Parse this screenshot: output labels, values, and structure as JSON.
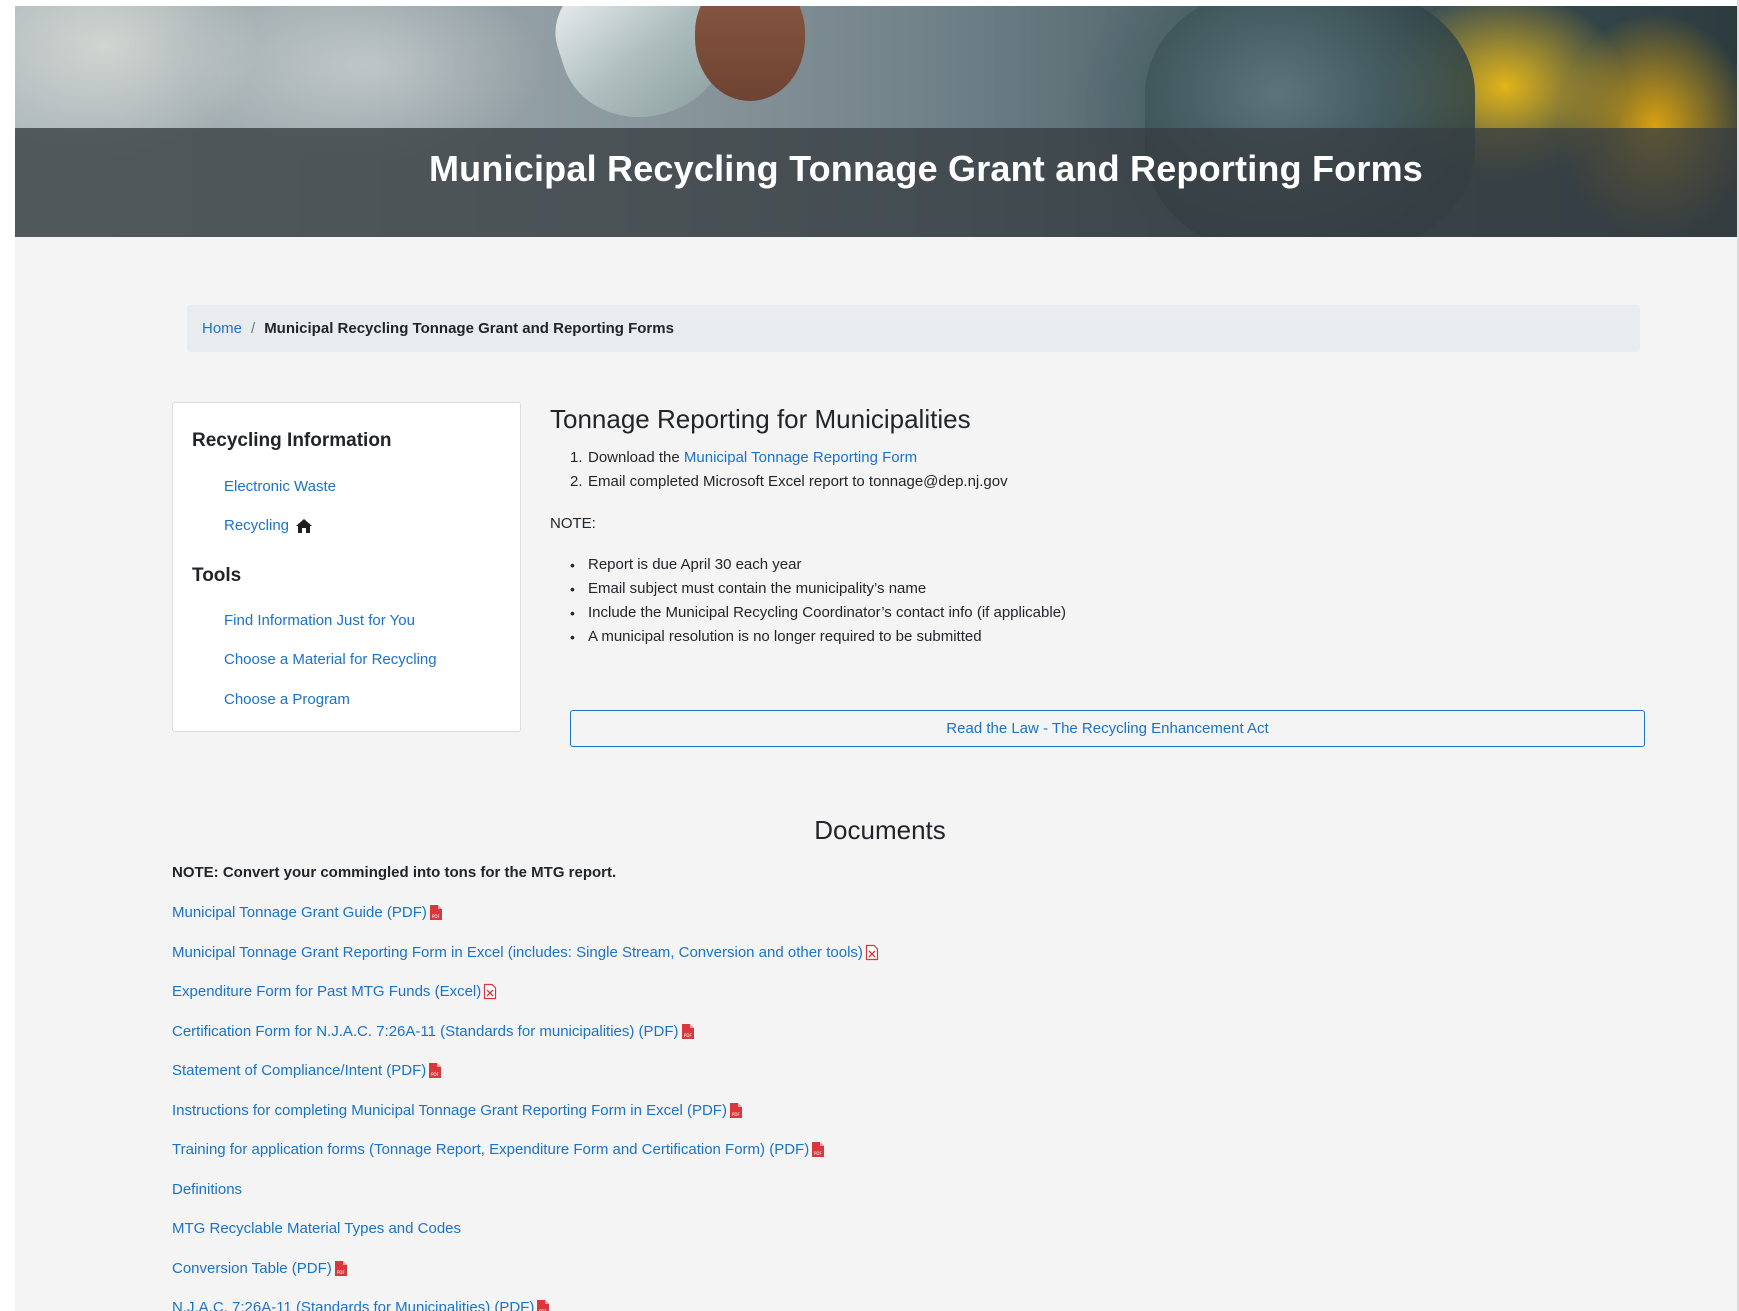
{
  "hero": {
    "title": "Municipal Recycling Tonnage Grant and Reporting Forms"
  },
  "breadcrumb": {
    "home": "Home",
    "separator": "/",
    "current": "Municipal Recycling Tonnage Grant and Reporting Forms"
  },
  "sidebar": {
    "section1_title": "Recycling Information",
    "section1_items": [
      {
        "label": "Electronic Waste"
      },
      {
        "label": "Recycling",
        "icon": "home-icon"
      }
    ],
    "section2_title": "Tools",
    "section2_items": [
      {
        "label": "Find Information Just for You"
      },
      {
        "label": "Choose a Material for Recycling"
      },
      {
        "label": "Choose a Program"
      }
    ]
  },
  "main": {
    "heading": "Tonnage Reporting for Municipalities",
    "steps": [
      {
        "num": "1.",
        "prefix": "Download the ",
        "link": "Municipal Tonnage Reporting Form"
      },
      {
        "num": "2.",
        "text": "Email completed Microsoft Excel report to tonnage@dep.nj.gov"
      }
    ],
    "note_label": "NOTE:",
    "notes": [
      "Report is due April 30 each year",
      "Email subject must contain the municipality’s name",
      "Include the Municipal Recycling Coordinator’s contact info (if applicable)",
      "A municipal resolution is no longer required to be submitted"
    ],
    "law_button": "Read the Law - The Recycling Enhancement Act"
  },
  "documents": {
    "title": "Documents",
    "note": "NOTE: Convert your commingled into tons for the MTG report.",
    "links": [
      {
        "label": "Municipal Tonnage Grant Guide (PDF)",
        "icon": "pdf-icon"
      },
      {
        "label": "Municipal Tonnage Grant Reporting Form in Excel (includes: Single Stream, Conversion and other tools)",
        "icon": "excel-icon"
      },
      {
        "label": "Expenditure Form for Past MTG Funds (Excel)",
        "icon": "excel-icon"
      },
      {
        "label": "Certification Form for N.J.A.C. 7:26A-11 (Standards for municipalities) (PDF)",
        "icon": "pdf-icon"
      },
      {
        "label": "Statement of Compliance/Intent (PDF)",
        "icon": "pdf-icon"
      },
      {
        "label": "Instructions for completing Municipal Tonnage Grant Reporting Form in Excel (PDF)",
        "icon": "pdf-icon"
      },
      {
        "label": "Training for application forms (Tonnage Report, Expenditure Form and Certification Form) (PDF)",
        "icon": "pdf-icon"
      },
      {
        "label": "Definitions",
        "icon": ""
      },
      {
        "label": "MTG Recyclable Material Types and Codes",
        "icon": ""
      },
      {
        "label": "Conversion Table (PDF)",
        "icon": "pdf-icon"
      },
      {
        "label": "N.J.A.C. 7:26A-11 (Standards for Municipalities) (PDF)",
        "icon": "pdf-icon"
      }
    ]
  },
  "colors": {
    "link": "#1a73c9",
    "pdf_icon": "#d9363e",
    "page_bg": "#f4f4f4",
    "breadcrumb_bg": "#e9ecef"
  }
}
